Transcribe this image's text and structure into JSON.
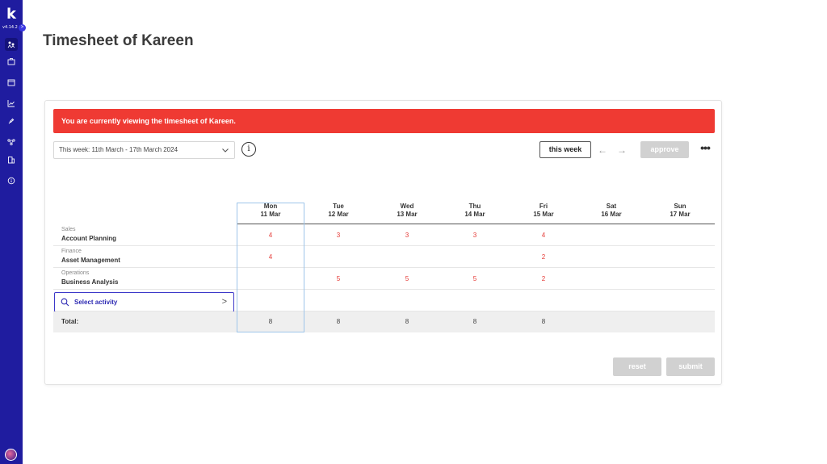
{
  "app": {
    "logo_letter": "k",
    "version": "v4.14.2",
    "collapse_glyph": ">"
  },
  "sidebar": {
    "items": [
      {
        "name": "team-icon",
        "active": true
      },
      {
        "name": "briefcase-icon",
        "active": false
      },
      {
        "name": "calendar-icon",
        "active": false
      },
      {
        "name": "chart-icon",
        "active": false
      },
      {
        "name": "plug-icon",
        "active": false
      },
      {
        "name": "network-icon",
        "active": false
      },
      {
        "name": "building-icon",
        "active": false
      },
      {
        "name": "info-icon",
        "active": false
      }
    ]
  },
  "page": {
    "title": "Timesheet of Kareen"
  },
  "alert": {
    "text": "You are currently viewing the timesheet of Kareen.",
    "color": "#ef3a33"
  },
  "toolbar": {
    "week_value": "This week: 11th March - 17th March 2024",
    "info_label": "i",
    "this_week_label": "this week",
    "prev_glyph": "←",
    "next_glyph": "→",
    "approve_label": "approve",
    "more_glyph": "•••"
  },
  "days": [
    {
      "day": "Mon",
      "date": "11 Mar"
    },
    {
      "day": "Tue",
      "date": "12 Mar"
    },
    {
      "day": "Wed",
      "date": "13 Mar"
    },
    {
      "day": "Thu",
      "date": "14 Mar"
    },
    {
      "day": "Fri",
      "date": "15 Mar"
    },
    {
      "day": "Sat",
      "date": "16 Mar"
    },
    {
      "day": "Sun",
      "date": "17 Mar"
    }
  ],
  "rows": [
    {
      "category": "Sales",
      "activity": "Account Planning",
      "hours": [
        "4",
        "3",
        "3",
        "3",
        "4",
        "",
        ""
      ]
    },
    {
      "category": "Finance",
      "activity": "Asset Management",
      "hours": [
        "4",
        "",
        "",
        "",
        "2",
        "",
        ""
      ]
    },
    {
      "category": "Operations",
      "activity": "Business Analysis",
      "hours": [
        "",
        "5",
        "5",
        "5",
        "2",
        "",
        ""
      ]
    }
  ],
  "select_activity": {
    "label": "Select activity",
    "arrow": ">"
  },
  "totals": {
    "label": "Total:",
    "values": [
      "8",
      "8",
      "8",
      "8",
      "8",
      "",
      ""
    ]
  },
  "footer": {
    "reset_label": "reset",
    "submit_label": "submit"
  },
  "colors": {
    "sidebar": "#1f1c9f",
    "accent": "#3d39c9",
    "hours_text": "#e53935",
    "disabled_button": "#d1d1d1"
  }
}
